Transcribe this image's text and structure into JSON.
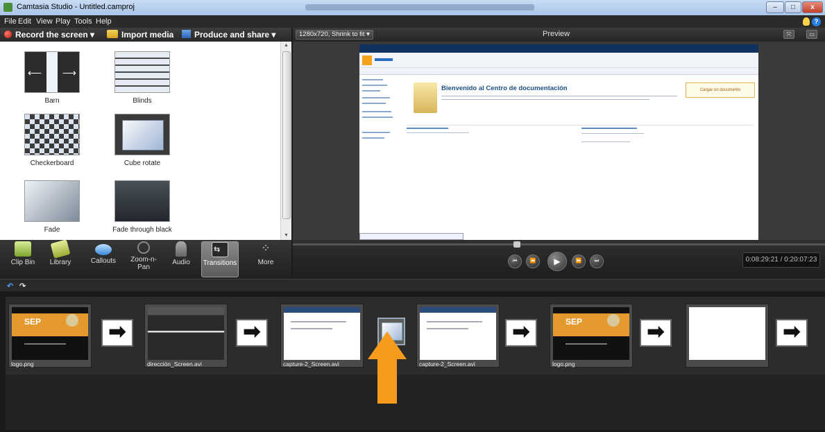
{
  "window": {
    "title": "Camtasia Studio - Untitled.camproj",
    "minimize": "–",
    "maximize": "□",
    "close": "x"
  },
  "menu": [
    "File",
    "Edit",
    "View",
    "Play",
    "Tools",
    "Help"
  ],
  "toolbar": {
    "record": "Record the screen ▾",
    "import": "Import media",
    "produce": "Produce and share ▾"
  },
  "preview": {
    "size_dropdown": "1280x720, Shrink to fit ▾",
    "title": "Preview",
    "time": "0:08:29:21 / 0:20:07:23",
    "sharepoint_heading": "Bienvenido al Centro de documentación",
    "upload_button": "Cargar un documento",
    "scrub_position": 0.42
  },
  "transitions": [
    {
      "name": "Barn"
    },
    {
      "name": "Blinds"
    },
    {
      "name": "Checkerboard"
    },
    {
      "name": "Cube rotate"
    },
    {
      "name": "Fade"
    },
    {
      "name": "Fade through black"
    }
  ],
  "tabs": [
    "Clip Bin",
    "Library",
    "Callouts",
    "Zoom-n-Pan",
    "Audio",
    "Transitions",
    "More"
  ],
  "active_tab": "Transitions",
  "storyboard": {
    "clips": [
      {
        "label": "logo.png",
        "kind": "logo"
      },
      {
        "label": "dirección_Screen.avi",
        "kind": "dark"
      },
      {
        "label": "capture-2_Screen.avi",
        "kind": "screen"
      },
      {
        "label": "capture-2_Screen.avi",
        "kind": "screen"
      },
      {
        "label": "logo.png",
        "kind": "logo"
      },
      {
        "label": "",
        "kind": "blank"
      }
    ],
    "logo_text": "SEP"
  },
  "colors": {
    "accent_orange": "#f79b1e",
    "sharepoint_blue": "#10335e"
  }
}
